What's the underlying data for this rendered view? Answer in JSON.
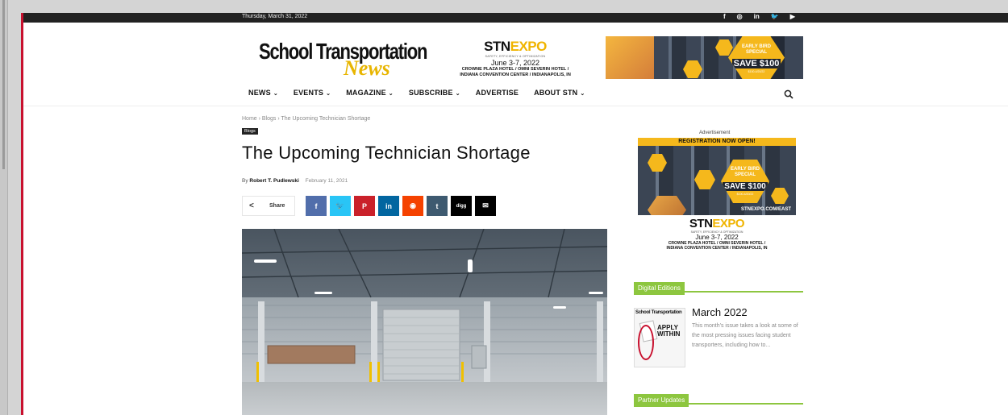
{
  "topbar": {
    "date": "Thursday, March 31, 2022",
    "social_icons": [
      "facebook-icon",
      "instagram-icon",
      "linkedin-icon",
      "twitter-icon",
      "youtube-icon"
    ],
    "social_glyphs": [
      "f",
      "◎",
      "in",
      "🐦",
      "▶"
    ]
  },
  "logo": {
    "line1": "School Transportation",
    "line2": "News"
  },
  "expo": {
    "brand_a": "STN",
    "brand_b": "EXPO",
    "tagline": "SAFETY, EFFICIENCY & OPTIMIZATION",
    "dates": "June 3-7, 2022",
    "venue1": "CROWNE PLAZA HOTEL / OMNI SEVERIN HOTEL /",
    "venue2": "INDIANA CONVENTION CENTER / INDIANAPOLIS, IN"
  },
  "banner": {
    "line1": "EARLY BIRD",
    "line2": "SPECIAL",
    "price": "SAVE $100",
    "fine": "$100-4/20/22"
  },
  "nav": {
    "items": [
      {
        "label": "NEWS",
        "chev": "⌄"
      },
      {
        "label": "EVENTS",
        "chev": "⌄"
      },
      {
        "label": "MAGAZINE",
        "chev": "⌄"
      },
      {
        "label": "SUBSCRIBE",
        "chev": "⌄"
      },
      {
        "label": "ADVERTISE",
        "chev": ""
      },
      {
        "label": "ABOUT STN",
        "chev": "⌄"
      }
    ]
  },
  "article": {
    "breadcrumb": "Home › Blogs › The Upcoming Technician Shortage",
    "category": "Blogs",
    "title": "The Upcoming Technician Shortage",
    "by": "By",
    "author": "Robert T. Pudlewski",
    "date": "February 11, 2021",
    "share_label": "Share",
    "share_buttons": [
      {
        "name": "facebook-share-button",
        "glyph": "f",
        "color": "#516eab"
      },
      {
        "name": "twitter-share-button",
        "glyph": "🐦",
        "color": "#29c5f6"
      },
      {
        "name": "pinterest-share-button",
        "glyph": "P",
        "color": "#ca212a"
      },
      {
        "name": "linkedin-share-button",
        "glyph": "in",
        "color": "#0266a0"
      },
      {
        "name": "reddit-share-button",
        "glyph": "◉",
        "color": "#f54200"
      },
      {
        "name": "tumblr-share-button",
        "glyph": "t",
        "color": "#3e5a70"
      },
      {
        "name": "digg-share-button",
        "glyph": "digg",
        "color": "#000000"
      },
      {
        "name": "email-share-button",
        "glyph": "✉",
        "color": "#000000"
      }
    ]
  },
  "sidebar": {
    "ad_label": "Advertisement",
    "ad_head": "REGISTRATION NOW OPEN!",
    "ad_url": "STNEXPO.COM/EAST",
    "digital_editions": "Digital Editions",
    "edition_title": "March 2022",
    "edition_desc": "This month's issue takes a look at some of the most pressing issues facing student transporters, including how to...",
    "cover_title": "School Transportation",
    "cover_headline": "APPLY WITHIN",
    "partner_updates": "Partner Updates"
  },
  "colors": {
    "accent_red": "#c8102e",
    "section_green": "#8dc63f",
    "expo_gold": "#f5b81c"
  }
}
